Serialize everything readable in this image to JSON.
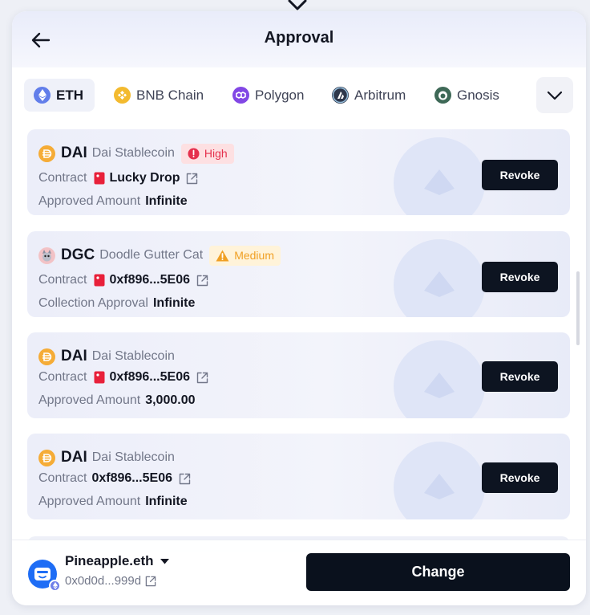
{
  "header": {
    "title": "Approval"
  },
  "chains": [
    {
      "label": "ETH",
      "icon": "eth-icon",
      "color": "#627eea",
      "active": true
    },
    {
      "label": "BNB Chain",
      "icon": "bnb-icon",
      "color": "#f3ba2f",
      "active": false
    },
    {
      "label": "Polygon",
      "icon": "polygon-icon",
      "color": "#8247e5",
      "active": false
    },
    {
      "label": "Arbitrum",
      "icon": "arbitrum-icon",
      "color": "#2d374b",
      "active": false
    },
    {
      "label": "Gnosis",
      "icon": "gnosis-icon",
      "color": "#3e6957",
      "active": false
    }
  ],
  "approvals": [
    {
      "symbol": "DAI",
      "name": "Dai Stablecoin",
      "risk": "High",
      "contract_label": "Contract",
      "contract": "Lucky Drop",
      "amount_label": "Approved Amount",
      "amount": "Infinite",
      "action": "Revoke"
    },
    {
      "symbol": "DGC",
      "name": "Doodle Gutter Cat",
      "risk": "Medium",
      "contract_label": "Contract",
      "contract": "0xf896...5E06",
      "amount_label": "Collection Approval",
      "amount": "Infinite",
      "action": "Revoke"
    },
    {
      "symbol": "DAI",
      "name": "Dai Stablecoin",
      "contract_label": "Contract",
      "contract": "0xf896...5E06",
      "amount_label": "Approved Amount",
      "amount": "3,000.00",
      "action": "Revoke"
    },
    {
      "symbol": "DAI",
      "name": "Dai Stablecoin",
      "contract_label": "Contract",
      "contract": "0xf896...5E06",
      "amount_label": "Approved Amount",
      "amount": "Infinite",
      "action": "Revoke"
    }
  ],
  "footer": {
    "account_name": "Pineapple.eth",
    "address": "0x0d0d...999d",
    "change_label": "Change"
  },
  "colors": {
    "primary_button": "#0d1421",
    "high_risk": "#e5304d",
    "medium_risk": "#f0a024",
    "dai": "#f5ac37",
    "contract_marker": "#e8203a"
  }
}
